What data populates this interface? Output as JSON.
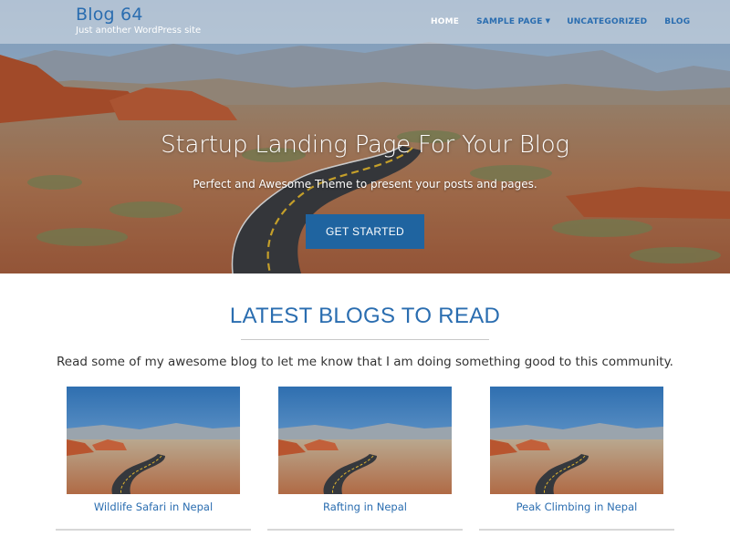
{
  "header": {
    "site_title": "Blog 64",
    "tagline": "Just another WordPress site",
    "nav": [
      {
        "label": "HOME",
        "active": true
      },
      {
        "label": "SAMPLE PAGE",
        "has_dropdown": true
      },
      {
        "label": "UNCATEGORIZED"
      },
      {
        "label": "BLOG"
      }
    ]
  },
  "hero": {
    "title": "Startup Landing Page For Your Blog",
    "subtitle": "Perfect and Awesome Theme to present your posts and pages.",
    "cta_label": "GET STARTED"
  },
  "latest": {
    "title": "LATEST BLOGS TO READ",
    "description": "Read some of my awesome blog to let me know that I am doing something good to this community.",
    "posts": [
      {
        "title": "Wildlife Safari in Nepal"
      },
      {
        "title": "Rafting in Nepal"
      },
      {
        "title": "Peak Climbing in Nepal"
      }
    ]
  },
  "colors": {
    "accent": "#2a6db0",
    "button": "#1f64a0"
  }
}
